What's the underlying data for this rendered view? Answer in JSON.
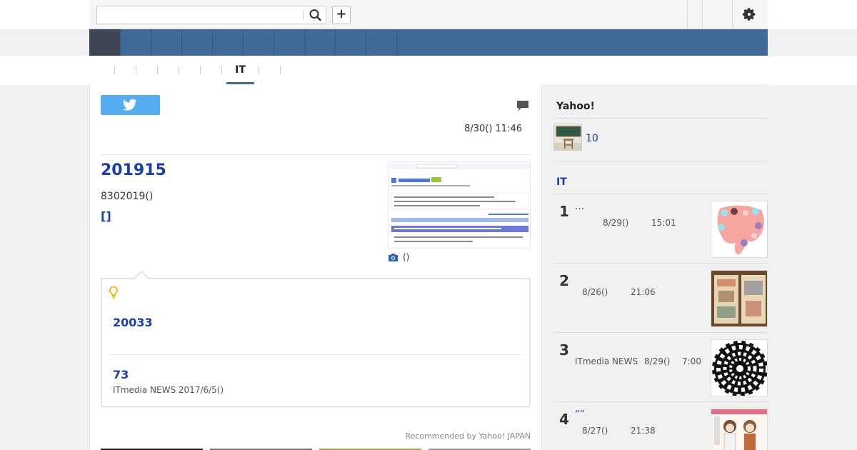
{
  "header": {
    "search": {
      "value": "",
      "placeholder": ""
    },
    "search_icon": "search-icon",
    "add_label": "+",
    "settings_icon": "gear-icon"
  },
  "nav": {
    "items": [
      "",
      "",
      "",
      "",
      "",
      "",
      "",
      "",
      "",
      ""
    ]
  },
  "categories": {
    "active_label": "IT"
  },
  "article": {
    "share_icon": "twitter-icon",
    "comment_icon": "comment-icon",
    "date": "8/30() 11:46",
    "headline": "201915",
    "subline": "8302019()",
    "bracket_link": "[]",
    "photo_caption": "()",
    "related": {
      "icon": "lightbulb-icon",
      "item1": "20033",
      "item2": "73",
      "item2_source": "ITmedia NEWS 2017/6/5()"
    },
    "recommended": "Recommended by Yahoo! JAPAN"
  },
  "sidebar": {
    "yahoo_title": "Yahoo!",
    "weather_link": "10",
    "it_title": "IT",
    "ranking": [
      {
        "rank": "1",
        "title": "…",
        "source": "",
        "date": "8/29()",
        "time": "15:01"
      },
      {
        "rank": "2",
        "title": "",
        "source": "",
        "date": "8/26()",
        "time": "21:06"
      },
      {
        "rank": "3",
        "title": "",
        "source": "ITmedia NEWS",
        "date": "8/29()",
        "time": "7:00"
      },
      {
        "rank": "4",
        "title": "“”",
        "source": "",
        "date": "8/27()",
        "time": "21:38"
      }
    ]
  },
  "colors": {
    "nav_blue": "#406b98",
    "nav_active": "#3d4554",
    "link_blue": "#1a3fa6",
    "twitter_blue": "#55acee"
  }
}
